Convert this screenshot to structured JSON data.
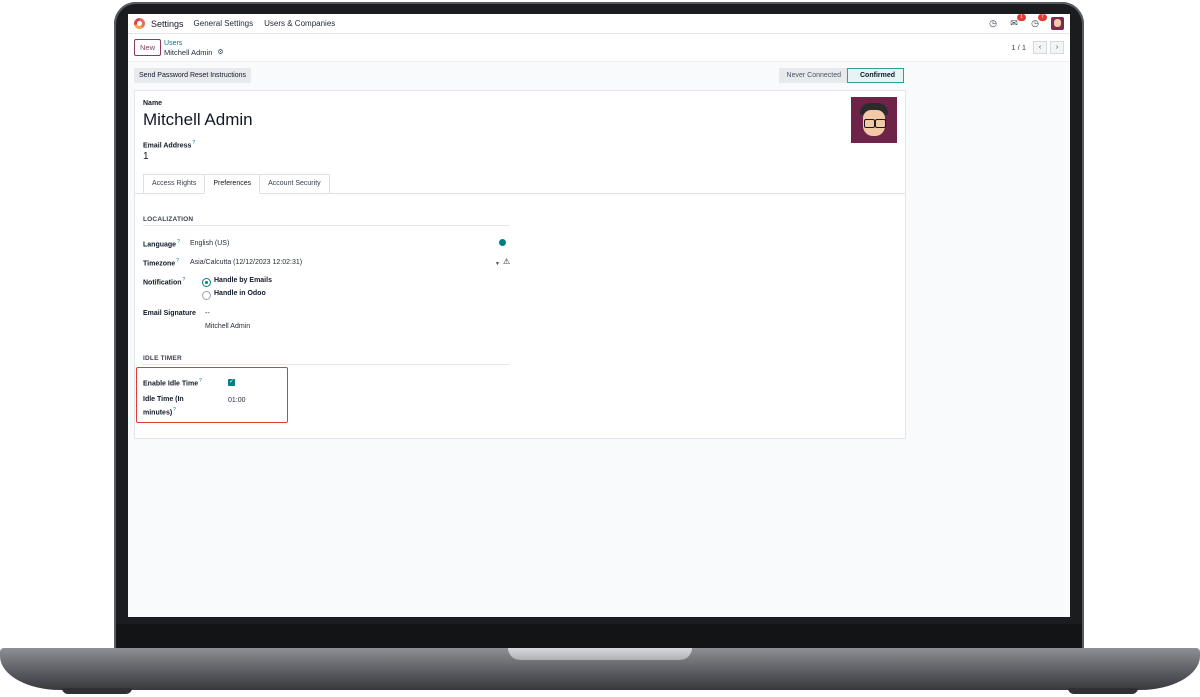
{
  "navbar": {
    "app_name": "Settings",
    "menu": [
      "General Settings",
      "Users & Companies"
    ],
    "chat_badge": "1",
    "activity_badge": "7"
  },
  "control_panel": {
    "new_label": "New",
    "breadcrumb_parent": "Users",
    "breadcrumb_current": "Mitchell Admin",
    "pager": "1 / 1"
  },
  "statusbar": {
    "reset_button": "Send Password Reset Instructions",
    "stages": [
      "Never Connected",
      "Confirmed"
    ],
    "active_stage": "Confirmed"
  },
  "form": {
    "name_label": "Name",
    "name_value": "Mitchell Admin",
    "email_label": "Email Address",
    "email_value": "1",
    "tabs": [
      "Access Rights",
      "Preferences",
      "Account Security"
    ],
    "active_tab": "Preferences",
    "localization": {
      "title": "LOCALIZATION",
      "language_label": "Language",
      "language_value": "English (US)",
      "timezone_label": "Timezone",
      "timezone_value": "Asia/Calcutta (12/12/2023 12:02:31)",
      "notification_label": "Notification",
      "notification_options": [
        "Handle by Emails",
        "Handle in Odoo"
      ],
      "notification_selected": "Handle by Emails",
      "signature_label": "Email Signature",
      "signature_line1": "--",
      "signature_line2": "Mitchell Admin"
    },
    "idle_timer": {
      "title": "IDLE TIMER",
      "enable_label": "Enable Idle Time",
      "enable_checked": true,
      "time_label_line1": "Idle Time (In",
      "time_label_line2": "minutes)",
      "time_value": "01:00"
    }
  },
  "colors": {
    "accent": "#017e84",
    "brand": "#8c3a5b",
    "highlight": "#e03a31"
  }
}
